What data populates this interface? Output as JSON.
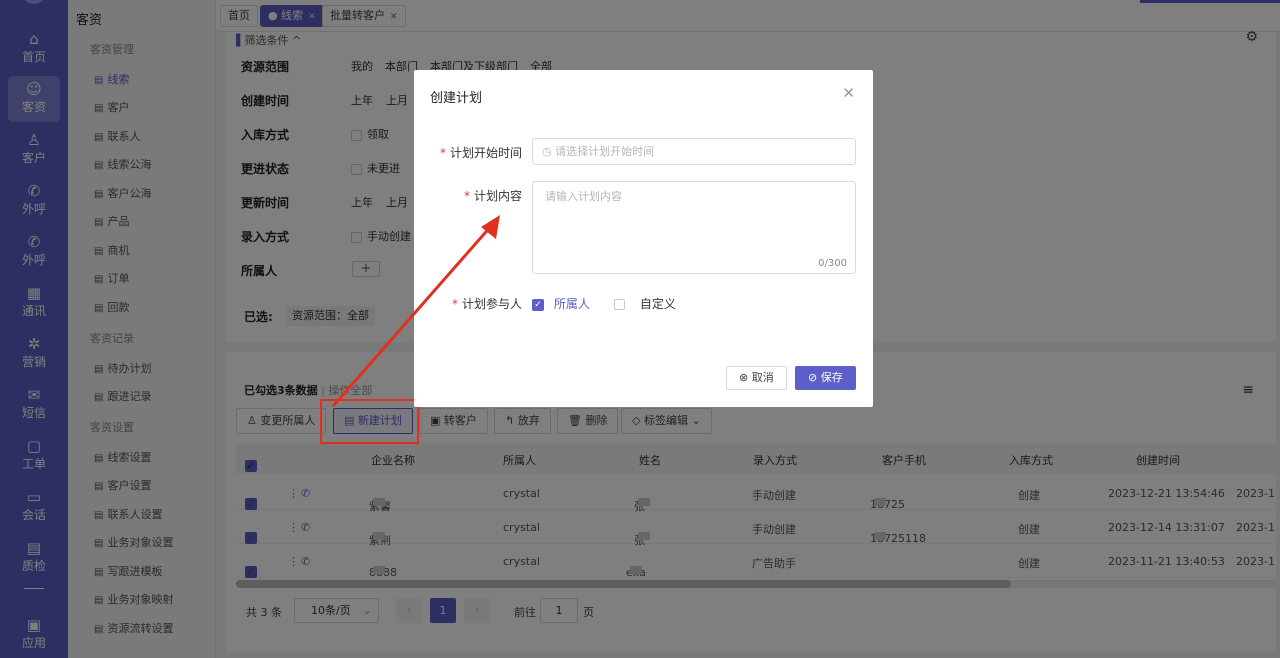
{
  "nav": [
    {
      "label": "首页",
      "icon": "home-icon"
    },
    {
      "label": "客资",
      "icon": "users-icon"
    },
    {
      "label": "客户",
      "icon": "user-icon"
    },
    {
      "label": "外呼",
      "icon": "phone-icon"
    },
    {
      "label": "外呼",
      "icon": "phone-out-icon"
    },
    {
      "label": "通讯",
      "icon": "contacts-icon"
    },
    {
      "label": "营销",
      "icon": "marketing-icon"
    },
    {
      "label": "短信",
      "icon": "message-icon"
    },
    {
      "label": "工单",
      "icon": "clipboard-icon"
    },
    {
      "label": "会话",
      "icon": "chat-icon"
    },
    {
      "label": "质检",
      "icon": "calendar-icon"
    },
    {
      "label": "应用",
      "icon": "apps-icon"
    }
  ],
  "sidebar": {
    "title": "客资",
    "groups": [
      "客资管理",
      "客资记录",
      "客资设置"
    ],
    "items": [
      "线索",
      "客户",
      "联系人",
      "线索公海",
      "客户公海",
      "产品",
      "商机",
      "订单",
      "回款",
      "待办计划",
      "跟进记录",
      "线索设置",
      "客户设置",
      "联系人设置",
      "业务对象设置",
      "写跟进模板",
      "业务对象映射",
      "资源流转设置"
    ]
  },
  "tabs": [
    "首页",
    "线索",
    "批量转客户"
  ],
  "filter": {
    "toggle": "筛选条件",
    "labels": [
      "资源范围",
      "创建时间",
      "入库方式",
      "更进状态",
      "更新时间",
      "录入方式",
      "所属人"
    ],
    "scope_options": [
      "我的",
      "本部门",
      "本部门及下级部门",
      "全部"
    ],
    "time1": [
      "上年",
      "上月"
    ],
    "time2": [
      "上年",
      "上月"
    ],
    "inbound": "领取",
    "status": "未更进",
    "entry": "手动创建",
    "plus": "+",
    "selected_label": "已选:",
    "selected_value": "资源范围：全部"
  },
  "list": {
    "selected_count": "已勾选3条数据",
    "select_all": "操作全部",
    "buttons": [
      "变更所属人",
      "新建计划",
      "转客户",
      "放弃",
      "删除",
      "标签编辑"
    ],
    "columns": [
      "企业名称",
      "所属人",
      "姓名",
      "录入方式",
      "客户手机",
      "入库方式",
      "创建时间"
    ],
    "rows": [
      {
        "company": "紫馨",
        "owner": "crystal",
        "name": "张",
        "entry": "手动创建",
        "phone": "18725",
        "inbound": "创建",
        "created": "2023-12-21 13:54:46",
        "more": "2023-1"
      },
      {
        "company": "紫荆",
        "owner": "crystal",
        "name": "张",
        "entry": "手动创建",
        "phone": "18725118",
        "inbound": "创建",
        "created": "2023-12-14 13:31:07",
        "more": "2023-1"
      },
      {
        "company": "8888",
        "owner": "crystal",
        "name": "exa",
        "entry": "广告助手",
        "phone": "",
        "inbound": "创建",
        "created": "2023-11-21 13:40:53",
        "more": "2023-1"
      }
    ],
    "pagination": {
      "total": "共 3 条",
      "page_size": "10条/页",
      "current": "1",
      "goto_label": "前往",
      "goto_value": "1",
      "page_unit": "页"
    }
  },
  "dialog": {
    "title": "创建计划",
    "start_label": "计划开始时间",
    "start_placeholder": "请选择计划开始时间",
    "content_label": "计划内容",
    "content_placeholder": "请输入计划内容",
    "counter": "0/300",
    "participants_label": "计划参与人",
    "opt_owner": "所属人",
    "opt_custom": "自定义",
    "cancel": "取消",
    "save": "保存"
  },
  "colors": {
    "accent": "#5b5fc7",
    "annotation": "#e0301e"
  }
}
